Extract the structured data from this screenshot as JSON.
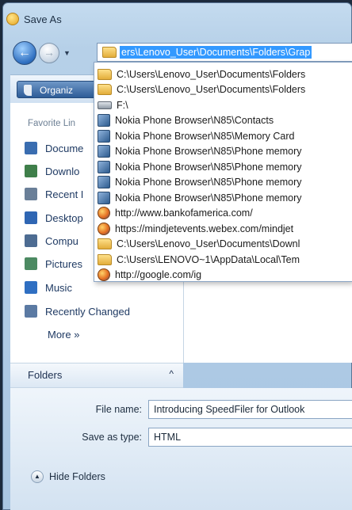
{
  "window": {
    "title": "Save As"
  },
  "address": {
    "value": "ers\\Lenovo_User\\Documents\\Folders\\Grap"
  },
  "toolbar": {
    "organize_label": "Organiz"
  },
  "sidebar": {
    "favorites_title": "Favorite Lin",
    "items": [
      {
        "label": "Docume",
        "icon": "documents-icon",
        "color": "#3a6db0"
      },
      {
        "label": "Downlo",
        "icon": "downloads-icon",
        "color": "#3f7f4a"
      },
      {
        "label": "Recent I",
        "icon": "recent-items-icon",
        "color": "#6a7f98"
      },
      {
        "label": "Desktop",
        "icon": "desktop-icon",
        "color": "#2f66b3"
      },
      {
        "label": "Compu",
        "icon": "computer-icon",
        "color": "#4d6c92"
      },
      {
        "label": "Pictures",
        "icon": "pictures-icon",
        "color": "#4c8a62"
      },
      {
        "label": "Music",
        "icon": "music-icon",
        "color": "#2f6fc2"
      },
      {
        "label": "Recently Changed",
        "icon": "recently-changed-icon",
        "color": "#5b7aa3"
      }
    ],
    "more_label": "More",
    "more_glyph": "»",
    "folders_label": "Folders",
    "folders_glyph": "^"
  },
  "history_dropdown": {
    "items": [
      {
        "text": "C:\\Users\\Lenovo_User\\Documents\\Folders",
        "icon": "folder-icon"
      },
      {
        "text": "C:\\Users\\Lenovo_User\\Documents\\Folders",
        "icon": "folder-icon"
      },
      {
        "text": "F:\\",
        "icon": "drive-icon"
      },
      {
        "text": "Nokia Phone Browser\\N85\\Contacts",
        "icon": "phone-icon"
      },
      {
        "text": "Nokia Phone Browser\\N85\\Memory Card",
        "icon": "phone-icon"
      },
      {
        "text": "Nokia Phone Browser\\N85\\Phone memory",
        "icon": "phone-icon"
      },
      {
        "text": "Nokia Phone Browser\\N85\\Phone memory",
        "icon": "phone-icon"
      },
      {
        "text": "Nokia Phone Browser\\N85\\Phone memory",
        "icon": "phone-icon"
      },
      {
        "text": "Nokia Phone Browser\\N85\\Phone memory",
        "icon": "phone-icon"
      },
      {
        "text": "http://www.bankofamerica.com/",
        "icon": "web-icon"
      },
      {
        "text": "https://mindjetevents.webex.com/mindjet",
        "icon": "web-icon"
      },
      {
        "text": "C:\\Users\\Lenovo_User\\Documents\\Downl",
        "icon": "folder-icon"
      },
      {
        "text": "C:\\Users\\LENOVO~1\\AppData\\Local\\Tem",
        "icon": "folder-icon"
      },
      {
        "text": "http://google.com/ig",
        "icon": "web-icon"
      }
    ]
  },
  "form": {
    "file_name_label": "File name:",
    "file_name_value": "Introducing SpeedFiler for Outlook",
    "save_type_label": "Save as type:",
    "save_type_value": "HTML",
    "hide_folders_label": "Hide Folders"
  },
  "colors": {
    "selection": "#3399ff",
    "frame": "#b6d0e8"
  }
}
